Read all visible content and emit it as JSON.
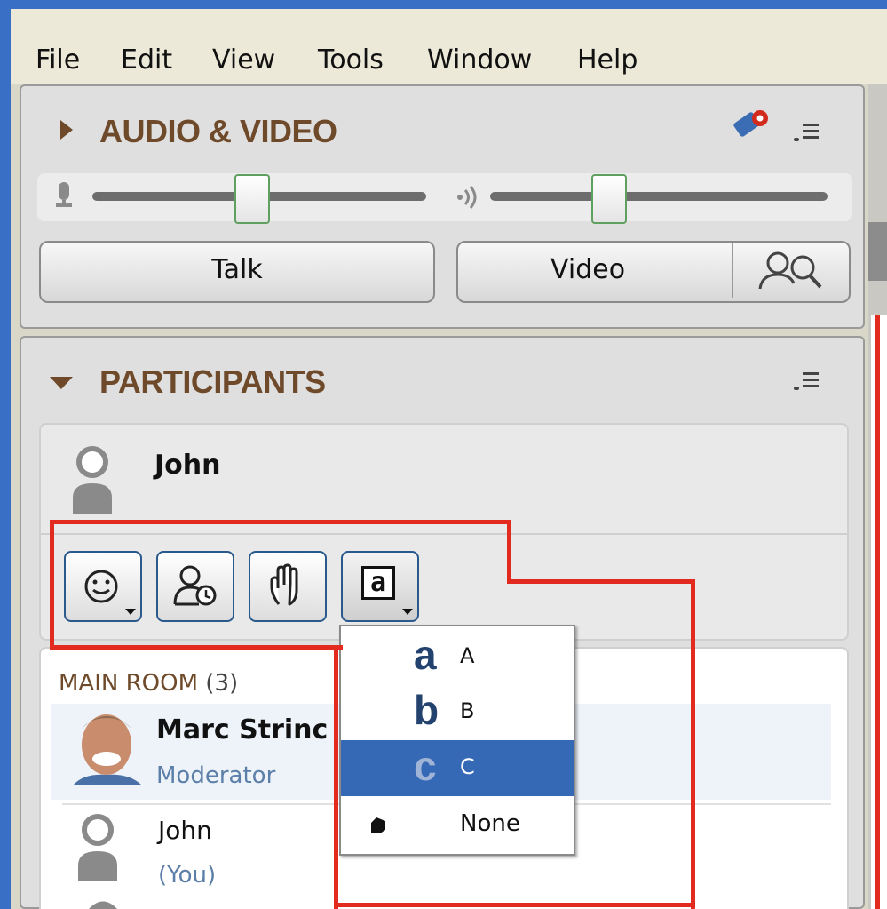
{
  "menu": [
    "File",
    "Edit",
    "View",
    "Tools",
    "Window",
    "Help"
  ],
  "audio_video": {
    "title": "AUDIO & VIDEO",
    "talk_label": "Talk",
    "video_label": "Video"
  },
  "participants": {
    "title": "PARTICIPANTS",
    "current_user": "John",
    "room_label": "MAIN ROOM",
    "room_count": "(3)",
    "list": [
      {
        "name": "Marc Strinc",
        "role": "Moderator"
      },
      {
        "name": "John",
        "role": "(You)"
      }
    ]
  },
  "dropdown": {
    "items": [
      {
        "glyph": "a",
        "label": "A",
        "selected": false
      },
      {
        "glyph": "b",
        "label": "B",
        "selected": false
      },
      {
        "glyph": "c",
        "label": "C",
        "selected": true
      },
      {
        "glyph": "",
        "label": "None",
        "selected": false
      }
    ]
  },
  "colors": {
    "section_title": "#6e4a2a",
    "selection": "#3569b5",
    "highlight_outline": "#e22b1e",
    "window_frame": "#3a6fc6"
  }
}
